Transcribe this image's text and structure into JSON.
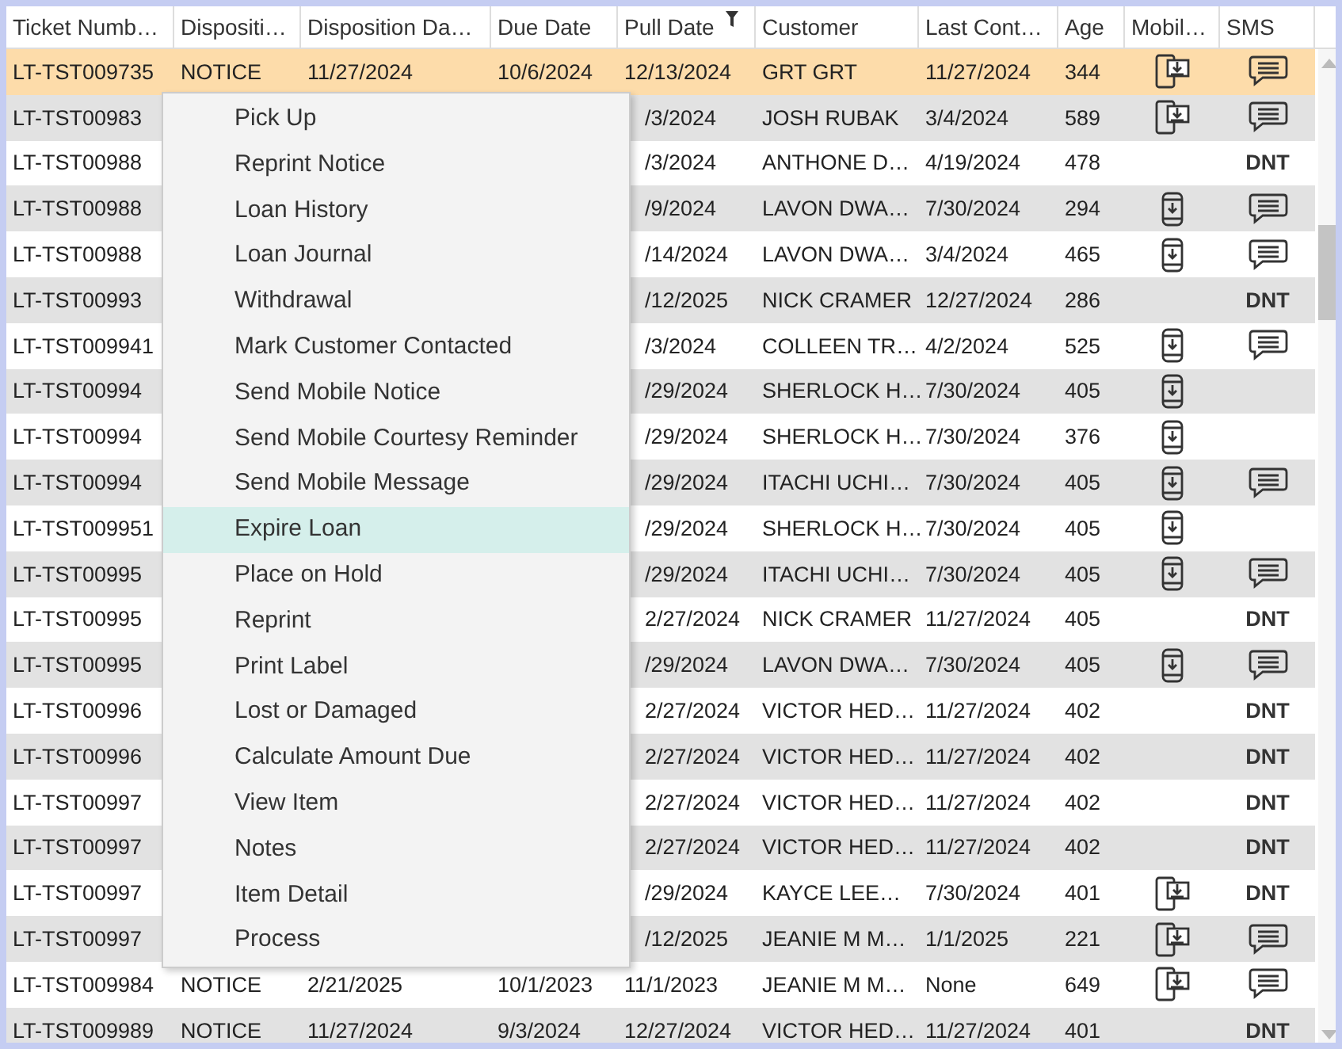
{
  "table": {
    "columns": [
      {
        "label": "Ticket Numb…",
        "filtered": false
      },
      {
        "label": "Dispositi…",
        "filtered": false
      },
      {
        "label": "Disposition Da…",
        "filtered": false
      },
      {
        "label": "Due Date",
        "filtered": false
      },
      {
        "label": "Pull Date",
        "filtered": true
      },
      {
        "label": "Customer",
        "filtered": false
      },
      {
        "label": "Last Cont…",
        "filtered": false
      },
      {
        "label": "Age",
        "filtered": false
      },
      {
        "label": "Mobil…",
        "filtered": false
      },
      {
        "label": "SMS",
        "filtered": false
      }
    ],
    "rows": [
      {
        "selected": true,
        "ticket": "LT-TST009735",
        "disposition": "NOTICE",
        "disposition_date": "11/27/2024",
        "due_date": "10/6/2024",
        "pull_date": "12/13/2024",
        "customer": "GRT GRT",
        "last_contact": "11/27/2024",
        "age": "344",
        "mobile": {
          "kind": "tablet"
        },
        "sms": {
          "kind": "icon"
        }
      },
      {
        "selected": false,
        "ticket": "LT-TST00983",
        "pull_date_part": "/3/2024",
        "customer": "JOSH RUBAK",
        "last_contact": "3/4/2024",
        "age": "589",
        "mobile": {
          "kind": "tablet"
        },
        "sms": {
          "kind": "icon"
        }
      },
      {
        "selected": false,
        "ticket": "LT-TST00988",
        "pull_date_part": "/3/2024",
        "customer": "ANTHONE D…",
        "last_contact": "4/19/2024",
        "age": "478",
        "sms": {
          "kind": "text",
          "text": "DNT"
        }
      },
      {
        "selected": false,
        "ticket": "LT-TST00988",
        "pull_date_part": "/9/2024",
        "customer": "LAVON DWA…",
        "last_contact": "7/30/2024",
        "age": "294",
        "mobile": {
          "kind": "phone"
        },
        "sms": {
          "kind": "icon"
        }
      },
      {
        "selected": false,
        "ticket": "LT-TST00988",
        "pull_date_part": "/14/2024",
        "customer": "LAVON DWA…",
        "last_contact": "3/4/2024",
        "age": "465",
        "mobile": {
          "kind": "phone"
        },
        "sms": {
          "kind": "icon"
        }
      },
      {
        "selected": false,
        "ticket": "LT-TST00993",
        "pull_date_part": "/12/2025",
        "customer": "NICK CRAMER",
        "last_contact": "12/27/2024",
        "age": "286",
        "sms": {
          "kind": "text",
          "text": "DNT"
        }
      },
      {
        "selected": false,
        "ticket": "LT-TST009941",
        "pull_date_part": "/3/2024",
        "customer": "COLLEEN TR…",
        "last_contact": "4/2/2024",
        "age": "525",
        "mobile": {
          "kind": "phone"
        },
        "sms": {
          "kind": "icon"
        }
      },
      {
        "selected": false,
        "ticket": "LT-TST00994",
        "pull_date_part": "/29/2024",
        "customer": "SHERLOCK H…",
        "last_contact": "7/30/2024",
        "age": "405",
        "mobile": {
          "kind": "phone"
        }
      },
      {
        "selected": false,
        "ticket": "LT-TST00994",
        "pull_date_part": "/29/2024",
        "customer": "SHERLOCK H…",
        "last_contact": "7/30/2024",
        "age": "376",
        "mobile": {
          "kind": "phone"
        }
      },
      {
        "selected": false,
        "ticket": "LT-TST00994",
        "pull_date_part": "/29/2024",
        "customer": "ITACHI UCHI…",
        "last_contact": "7/30/2024",
        "age": "405",
        "mobile": {
          "kind": "phone"
        },
        "sms": {
          "kind": "icon"
        }
      },
      {
        "selected": false,
        "ticket": "LT-TST009951",
        "pull_date_part": "/29/2024",
        "customer": "SHERLOCK H…",
        "last_contact": "7/30/2024",
        "age": "405",
        "mobile": {
          "kind": "phone"
        }
      },
      {
        "selected": false,
        "ticket": "LT-TST00995",
        "pull_date_part": "/29/2024",
        "customer": "ITACHI UCHI…",
        "last_contact": "7/30/2024",
        "age": "405",
        "mobile": {
          "kind": "phone"
        },
        "sms": {
          "kind": "icon"
        }
      },
      {
        "selected": false,
        "ticket": "LT-TST00995",
        "pull_date_part": "2/27/2024",
        "customer": "NICK CRAMER",
        "last_contact": "11/27/2024",
        "age": "405",
        "sms": {
          "kind": "text",
          "text": "DNT"
        }
      },
      {
        "selected": false,
        "ticket": "LT-TST00995",
        "pull_date_part": "/29/2024",
        "customer": "LAVON DWA…",
        "last_contact": "7/30/2024",
        "age": "405",
        "mobile": {
          "kind": "phone"
        },
        "sms": {
          "kind": "icon"
        }
      },
      {
        "selected": false,
        "ticket": "LT-TST00996",
        "pull_date_part": "2/27/2024",
        "customer": "VICTOR HED…",
        "last_contact": "11/27/2024",
        "age": "402",
        "sms": {
          "kind": "text",
          "text": "DNT"
        }
      },
      {
        "selected": false,
        "ticket": "LT-TST00996",
        "pull_date_part": "2/27/2024",
        "customer": "VICTOR HED…",
        "last_contact": "11/27/2024",
        "age": "402",
        "sms": {
          "kind": "text",
          "text": "DNT"
        }
      },
      {
        "selected": false,
        "ticket": "LT-TST00997",
        "pull_date_part": "2/27/2024",
        "customer": "VICTOR HED…",
        "last_contact": "11/27/2024",
        "age": "402",
        "sms": {
          "kind": "text",
          "text": "DNT"
        }
      },
      {
        "selected": false,
        "ticket": "LT-TST00997",
        "pull_date_part": "2/27/2024",
        "customer": "VICTOR HED…",
        "last_contact": "11/27/2024",
        "age": "402",
        "sms": {
          "kind": "text",
          "text": "DNT"
        }
      },
      {
        "selected": false,
        "ticket": "LT-TST00997",
        "pull_date_part": "/29/2024",
        "customer": "KAYCE LEE…",
        "last_contact": "7/30/2024",
        "age": "401",
        "mobile": {
          "kind": "tablet"
        },
        "sms": {
          "kind": "text",
          "text": "DNT"
        }
      },
      {
        "selected": false,
        "ticket": "LT-TST00997",
        "pull_date_part": "/12/2025",
        "customer": "JEANIE M M…",
        "last_contact": "1/1/2025",
        "age": "221",
        "mobile": {
          "kind": "tablet"
        },
        "sms": {
          "kind": "icon"
        }
      },
      {
        "selected": false,
        "ticket": "LT-TST009984",
        "disposition": "NOTICE",
        "disposition_date": "2/21/2025",
        "due_date": "10/1/2023",
        "pull_date": "11/1/2023",
        "customer": "JEANIE M M…",
        "last_contact": "None",
        "age": "649",
        "mobile": {
          "kind": "tablet"
        },
        "sms": {
          "kind": "icon"
        }
      },
      {
        "selected": false,
        "ticket": "LT-TST009989",
        "disposition": "NOTICE",
        "disposition_date": "11/27/2024",
        "due_date": "9/3/2024",
        "pull_date": "12/27/2024",
        "customer": "VICTOR HED…",
        "last_contact": "11/27/2024",
        "age": "401",
        "sms": {
          "kind": "text",
          "text": "DNT"
        }
      }
    ]
  },
  "context_menu": {
    "items": [
      {
        "label": "Pick Up",
        "selected": false
      },
      {
        "label": "Reprint Notice",
        "selected": false
      },
      {
        "label": "Loan History",
        "selected": false
      },
      {
        "label": "Loan Journal",
        "selected": false
      },
      {
        "label": "Withdrawal",
        "selected": false
      },
      {
        "label": "Mark Customer Contacted",
        "selected": false
      },
      {
        "label": "Send Mobile Notice",
        "selected": false
      },
      {
        "label": "Send Mobile Courtesy Reminder",
        "selected": false
      },
      {
        "label": "Send Mobile Message",
        "selected": false
      },
      {
        "label": "Expire Loan",
        "selected": true
      },
      {
        "label": "Place on Hold",
        "selected": false
      },
      {
        "label": "Reprint",
        "selected": false
      },
      {
        "label": "Print Label",
        "selected": false
      },
      {
        "label": "Lost or Damaged",
        "selected": false
      },
      {
        "label": "Calculate Amount Due",
        "selected": false
      },
      {
        "label": "View Item",
        "selected": false
      },
      {
        "label": "Notes",
        "selected": false
      },
      {
        "label": "Item Detail",
        "selected": false
      },
      {
        "label": "Process",
        "selected": false
      }
    ]
  }
}
